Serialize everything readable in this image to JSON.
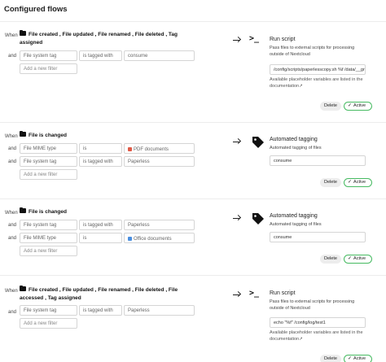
{
  "page_title": "Configured flows",
  "labels": {
    "when": "When",
    "and": "and",
    "delete": "Delete",
    "active": "Active",
    "add_filter": "Add a new filter"
  },
  "flows": [
    {
      "trigger": "File created ,  File updated ,  File renamed ,  File deleted ,  Tag assigned",
      "filters": [
        {
          "field": "File system tag",
          "op": "is tagged with",
          "value": "consume"
        }
      ],
      "operation": {
        "name": "Run script",
        "description": "Pass files to external scripts for processing outside of Nextcloud",
        "input": "/config/scripts/paperlesscopy.sh %f /data/__group",
        "hint": "Available placeholder variables are listed in the documentation↗"
      }
    },
    {
      "trigger": "File is changed",
      "filters": [
        {
          "field": "File MIME type",
          "op": "is",
          "value": "PDF documents"
        },
        {
          "field": "File system tag",
          "op": "is tagged with",
          "value": "Paperless"
        }
      ],
      "operation": {
        "name": "Automated tagging",
        "description": "Automated tagging of files",
        "input": "consume"
      }
    },
    {
      "trigger": "File is changed",
      "filters": [
        {
          "field": "File system tag",
          "op": "is tagged with",
          "value": "Paperless"
        },
        {
          "field": "File MIME type",
          "op": "is",
          "value": "Office documents"
        }
      ],
      "operation": {
        "name": "Automated tagging",
        "description": "Automated tagging of files",
        "input": "consume"
      }
    },
    {
      "trigger": "File created ,  File updated ,  File renamed ,  File deleted ,  File accessed ,  Tag assigned",
      "filters": [
        {
          "field": "File system tag",
          "op": "is tagged with",
          "value": "Paperless"
        }
      ],
      "operation": {
        "name": "Run script",
        "description": "Pass files to external scripts for processing outside of Nextcloud",
        "input": "echo \"%f\" /config/log/test1",
        "hint": "Available placeholder variables are listed in the documentation↗"
      }
    }
  ]
}
